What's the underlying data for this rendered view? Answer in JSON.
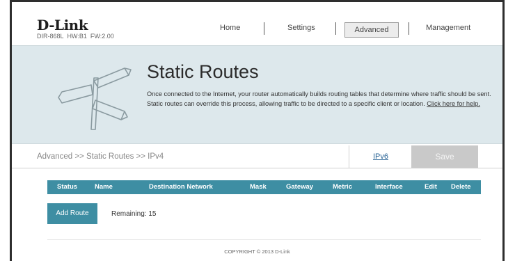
{
  "brand": {
    "logo": "D-Link",
    "model": "DIR-868L",
    "hw": "HW:B1",
    "fw": "FW:2.00"
  },
  "nav": {
    "home": "Home",
    "settings": "Settings",
    "advanced": "Advanced",
    "management": "Management"
  },
  "hero": {
    "title": "Static Routes",
    "description": "Once connected to the Internet, your router automatically builds routing tables that determine where traffic should be sent. Static routes can override this process, allowing traffic to be directed to a specific client or location.",
    "help_link": "Click here for help."
  },
  "breadcrumb": "Advanced >> Static Routes >> IPv4",
  "ipv6_tab": "IPv6",
  "save_label": "Save",
  "table": {
    "headers": [
      "Status",
      "Name",
      "Destination Network",
      "Mask",
      "Gateway",
      "Metric",
      "Interface",
      "Edit",
      "Delete"
    ]
  },
  "add_route": "Add Route",
  "remaining_label": "Remaining:",
  "remaining_value": "15",
  "copyright": "COPYRIGHT © 2013 D-Link",
  "colors": {
    "accent": "#3e8ea3",
    "hero_bg": "#dde8ec",
    "save_disabled": "#c9c9c9"
  }
}
